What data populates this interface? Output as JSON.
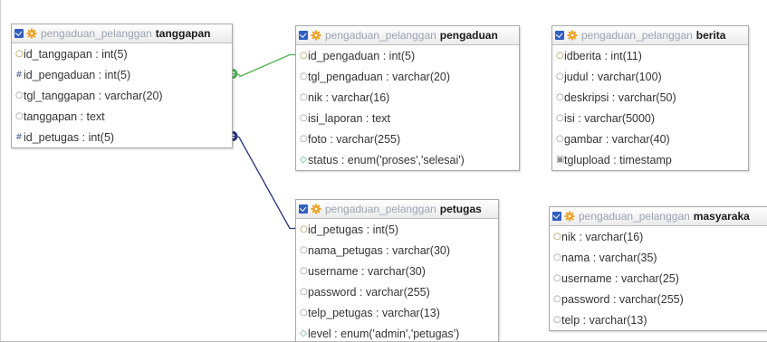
{
  "tables": [
    {
      "key": "tanggapan",
      "database": "pengaduan_pelanggan",
      "name": "tanggapan",
      "columns": [
        {
          "icon": "key",
          "text": "id_tanggapan : int(5)"
        },
        {
          "icon": "index",
          "text": "id_pengaduan : int(5)"
        },
        {
          "icon": "column",
          "text": "tgl_tanggapan : varchar(20)"
        },
        {
          "icon": "column",
          "text": "tanggapan : text"
        },
        {
          "icon": "index",
          "text": "id_petugas : int(5)"
        }
      ]
    },
    {
      "key": "pengaduan",
      "database": "pengaduan_pelanggan",
      "name": "pengaduan",
      "columns": [
        {
          "icon": "key",
          "text": "id_pengaduan : int(5)"
        },
        {
          "icon": "column",
          "text": "tgl_pengaduan : varchar(20)"
        },
        {
          "icon": "column",
          "text": "nik : varchar(16)"
        },
        {
          "icon": "column",
          "text": "isi_laporan : text"
        },
        {
          "icon": "column",
          "text": "foto : varchar(255)"
        },
        {
          "icon": "enum",
          "text": "status : enum('proses','selesai')"
        }
      ]
    },
    {
      "key": "berita",
      "database": "pengaduan_pelanggan",
      "name": "berita",
      "columns": [
        {
          "icon": "key",
          "text": "idberita : int(11)"
        },
        {
          "icon": "column",
          "text": "judul : varchar(100)"
        },
        {
          "icon": "column",
          "text": "deskripsi : varchar(50)"
        },
        {
          "icon": "column",
          "text": "isi : varchar(5000)"
        },
        {
          "icon": "column",
          "text": "gambar : varchar(40)"
        },
        {
          "icon": "timestamp",
          "text": "tglupload : timestamp"
        }
      ]
    },
    {
      "key": "petugas",
      "database": "pengaduan_pelanggan",
      "name": "petugas",
      "columns": [
        {
          "icon": "key",
          "text": "id_petugas : int(5)"
        },
        {
          "icon": "column",
          "text": "nama_petugas : varchar(30)"
        },
        {
          "icon": "column",
          "text": "username : varchar(30)"
        },
        {
          "icon": "column",
          "text": "password : varchar(255)"
        },
        {
          "icon": "column",
          "text": "telp_petugas : varchar(13)"
        },
        {
          "icon": "enum",
          "text": "level : enum('admin','petugas')"
        }
      ]
    },
    {
      "key": "masyarakat",
      "database": "pengaduan_pelanggan",
      "name": "masyaraka",
      "columns": [
        {
          "icon": "key",
          "text": "nik : varchar(16)"
        },
        {
          "icon": "column",
          "text": "nama : varchar(35)"
        },
        {
          "icon": "column",
          "text": "username : varchar(25)"
        },
        {
          "icon": "column",
          "text": "password : varchar(255)"
        },
        {
          "icon": "column",
          "text": "telp : varchar(13)"
        }
      ]
    }
  ],
  "relations": [
    {
      "from_table": "tanggapan",
      "from_column": "id_pengaduan",
      "to_table": "pengaduan",
      "to_column": "id_pengaduan",
      "color": "#4caf50"
    },
    {
      "from_table": "tanggapan",
      "from_column": "id_petugas",
      "to_table": "petugas",
      "to_column": "id_petugas",
      "color": "#26307a"
    }
  ],
  "colors": {
    "database_name": "#9aa3b5",
    "table_name": "#1a1a1a",
    "toggle_icon": "#2f5fbf",
    "settings_icon": "#f0a020"
  }
}
